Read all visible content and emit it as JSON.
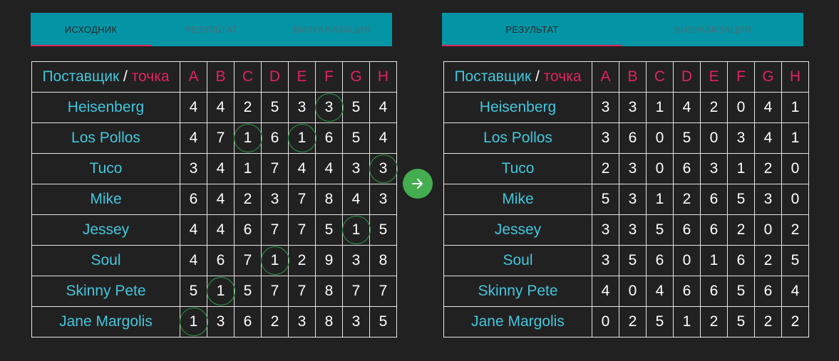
{
  "left": {
    "tabs": [
      "ИСХОДНИК",
      "РЕЗУЛЬТАТ",
      "ВИЗУАЛИЗАЦИЯ"
    ],
    "active_tab": 0,
    "header_supplier": "Поставщик",
    "header_sep": "/",
    "header_point": "точка",
    "columns": [
      "A",
      "B",
      "C",
      "D",
      "E",
      "F",
      "G",
      "H"
    ],
    "rows": [
      {
        "name": "Heisenberg",
        "values": [
          "4",
          "4",
          "2",
          "5",
          "3",
          "3",
          "5",
          "4"
        ],
        "circled": [
          5
        ]
      },
      {
        "name": "Los Pollos",
        "values": [
          "4",
          "7",
          "1",
          "6",
          "1",
          "6",
          "5",
          "4"
        ],
        "circled": [
          2,
          4
        ]
      },
      {
        "name": "Tuco",
        "values": [
          "3",
          "4",
          "1",
          "7",
          "4",
          "4",
          "3",
          "3"
        ],
        "circled": [
          7
        ]
      },
      {
        "name": "Mike",
        "values": [
          "6",
          "4",
          "2",
          "3",
          "7",
          "8",
          "4",
          "3"
        ],
        "circled": []
      },
      {
        "name": "Jessey",
        "values": [
          "4",
          "4",
          "6",
          "7",
          "7",
          "5",
          "1",
          "5"
        ],
        "circled": [
          6
        ]
      },
      {
        "name": "Soul",
        "values": [
          "4",
          "6",
          "7",
          "1",
          "2",
          "9",
          "3",
          "8"
        ],
        "circled": [
          3
        ]
      },
      {
        "name": "Skinny Pete",
        "values": [
          "5",
          "1",
          "5",
          "7",
          "7",
          "8",
          "7",
          "7"
        ],
        "circled": [
          1
        ]
      },
      {
        "name": "Jane Margolis",
        "values": [
          "1",
          "3",
          "6",
          "2",
          "3",
          "8",
          "3",
          "5"
        ],
        "circled": [
          0
        ]
      }
    ]
  },
  "right": {
    "tabs": [
      "РЕЗУЛЬТАТ",
      "ВИЗУАЛИЗАЦИЯ"
    ],
    "active_tab": 0,
    "header_supplier": "Поставщик",
    "header_sep": "/",
    "header_point": "точка",
    "columns": [
      "A",
      "B",
      "C",
      "D",
      "E",
      "F",
      "G",
      "H"
    ],
    "rows": [
      {
        "name": "Heisenberg",
        "values": [
          "3",
          "3",
          "1",
          "4",
          "2",
          "0",
          "4",
          "1"
        ]
      },
      {
        "name": "Los Pollos",
        "values": [
          "3",
          "6",
          "0",
          "5",
          "0",
          "3",
          "4",
          "1"
        ]
      },
      {
        "name": "Tuco",
        "values": [
          "2",
          "3",
          "0",
          "6",
          "3",
          "1",
          "2",
          "0"
        ]
      },
      {
        "name": "Mike",
        "values": [
          "5",
          "3",
          "1",
          "2",
          "6",
          "5",
          "3",
          "0"
        ]
      },
      {
        "name": "Jessey",
        "values": [
          "3",
          "3",
          "5",
          "6",
          "6",
          "2",
          "0",
          "2"
        ]
      },
      {
        "name": "Soul",
        "values": [
          "3",
          "5",
          "6",
          "0",
          "1",
          "6",
          "2",
          "5"
        ]
      },
      {
        "name": "Skinny Pete",
        "values": [
          "4",
          "0",
          "4",
          "6",
          "6",
          "5",
          "6",
          "4"
        ]
      },
      {
        "name": "Jane Margolis",
        "values": [
          "0",
          "2",
          "5",
          "1",
          "2",
          "5",
          "2",
          "2"
        ]
      }
    ]
  },
  "arrow_button": {
    "icon": "arrow-right-icon"
  },
  "colors": {
    "background": "#212121",
    "tab_bar": "#0395a6",
    "accent_pink": "#e0245e",
    "accent_cyan": "#44c6dc",
    "circle_green": "#2f9a44",
    "button_green": "#43ad4f"
  }
}
